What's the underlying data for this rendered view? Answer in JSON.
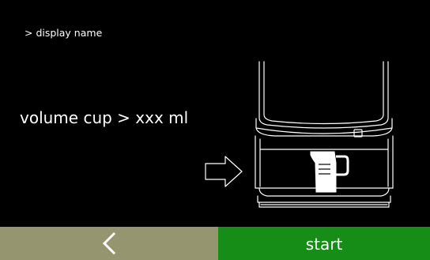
{
  "header": {
    "display_name": "> display name"
  },
  "main": {
    "volume_label": "volume cup > xxx ml",
    "illustration_icon": "coffee-machine-with-cup-icon",
    "pointer_icon": "arrow-right-outline-icon"
  },
  "footer": {
    "back_icon": "chevron-left-icon",
    "start_label": "start"
  },
  "colors": {
    "background": "#000000",
    "back_button": "#959670",
    "start_button": "#168D16",
    "text": "#FFFFFF"
  }
}
